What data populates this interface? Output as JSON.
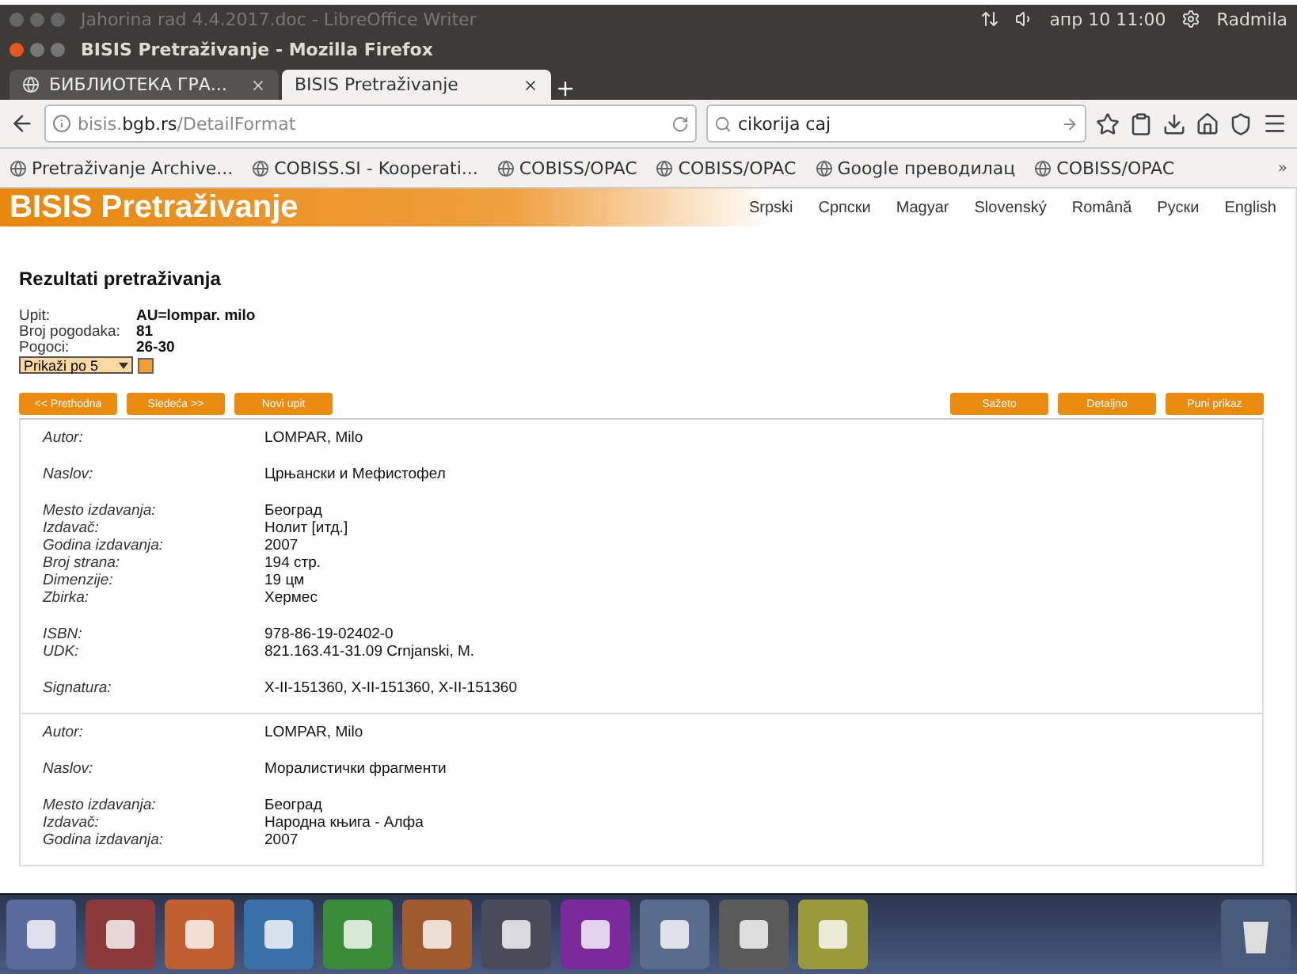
{
  "system_bar": {
    "window_title": "Jahorina rad 4.4.2017.doc - LibreOffice Writer",
    "clock": "апр 10 11:00",
    "user": "Radmila"
  },
  "browser": {
    "title": "BISIS Pretraživanje - Mozilla Firefox",
    "tabs": [
      {
        "label": "БИБЛИОТЕКА ГРА...",
        "selected": false
      },
      {
        "label": "BISIS Pretraživanje",
        "selected": true
      }
    ],
    "url": "bisis.**bgb.rs**/DetailFormat",
    "search": {
      "value": "cikorija caj"
    },
    "bookmarks": [
      "Pretraživanje Archive...",
      "COBISS.SI - Kooperati...",
      "COBISS/OPAC",
      "COBISS/OPAC",
      "Google преводилац",
      "COBISS/OPAC"
    ],
    "bookmarks_more": "»"
  },
  "page": {
    "logo": "BISIS Pretraživanje",
    "languages": [
      "Srpski",
      "Српски",
      "Magyar",
      "Slovenský",
      "Română",
      "Руски",
      "English"
    ],
    "heading": "Rezultati pretraživanja",
    "summary": [
      {
        "label": "Upit:",
        "value": "AU=lompar. milo"
      },
      {
        "label": "Broj pogodaka:",
        "value": "81"
      },
      {
        "label": "Pogoci:",
        "value": "26-30"
      }
    ],
    "page_size": "Prikaži po 5",
    "nav_buttons": [
      "<< Prethodna",
      "Sledeća >>",
      "Novi upit"
    ],
    "view_buttons": [
      "Sažeto",
      "Detaljno",
      "Puni prikaz"
    ],
    "records": [
      {
        "groups": [
          [
            {
              "label": "Autor:",
              "value": "LOMPAR, Milo"
            }
          ],
          [
            {
              "label": "Naslov:",
              "value": "Црњански и Мефистофел"
            }
          ],
          [
            {
              "label": "Mesto izdavanja:",
              "value": "Београд"
            },
            {
              "label": "Izdavač:",
              "value": "Нолит [итд.]"
            },
            {
              "label": "Godina izdavanja:",
              "value": "2007"
            },
            {
              "label": "Broj strana:",
              "value": "194 стр."
            },
            {
              "label": "Dimenzije:",
              "value": "19 цм"
            },
            {
              "label": "Zbirka:",
              "value": "Хермес"
            }
          ],
          [
            {
              "label": "ISBN:",
              "value": "978-86-19-02402-0"
            },
            {
              "label": "UDK:",
              "value": "821.163.41-31.09 Crnjanski, M."
            }
          ],
          [
            {
              "label": "Signatura:",
              "value": "X-II-151360, X-II-151360, X-II-151360"
            }
          ]
        ]
      },
      {
        "groups": [
          [
            {
              "label": "Autor:",
              "value": "LOMPAR, Milo"
            }
          ],
          [
            {
              "label": "Naslov:",
              "value": "Моралистички фрагменти"
            }
          ],
          [
            {
              "label": "Mesto izdavanja:",
              "value": "Београд"
            },
            {
              "label": "Izdavač:",
              "value": "Народна књига - Алфа"
            },
            {
              "label": "Godina izdavanja:",
              "value": "2007"
            }
          ]
        ]
      }
    ]
  }
}
